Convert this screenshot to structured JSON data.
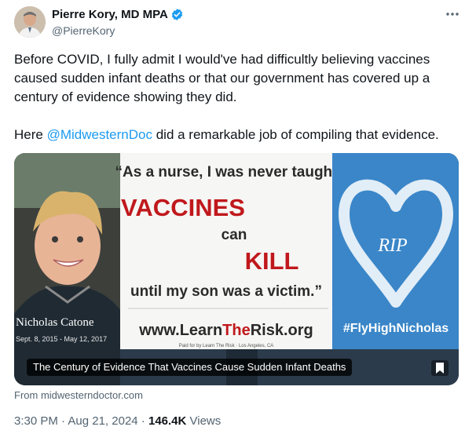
{
  "author": {
    "name": "Pierre Kory, MD MPA",
    "handle": "@PierreKory",
    "verified_icon": "verified-badge-icon"
  },
  "more_icon": "more-options-icon",
  "text": {
    "para1": "Before COVID, I fully admit I would've had difficultly believing vaccines caused sudden infant deaths or that our government has covered up a century of evidence showing they did.",
    "para2_prefix": "Here ",
    "mention": "@MidwesternDoc",
    "para2_suffix": " did a remarkable job of compiling that evidence."
  },
  "card": {
    "billboard": {
      "quote_line1": "“As a nurse, I was never taught",
      "word_vaccines": "VACCINES",
      "word_can": "can",
      "word_kill": "KILL",
      "quote_line_end": "until my son was a victim.”",
      "name": "Nicholas Catone",
      "dates": "Sept. 8, 2015 - May 12, 2017",
      "url_prefix": "www.Learn",
      "url_middle": "The",
      "url_suffix": "Risk.org",
      "paid_for": "Paid for by Learn The Risk · Los Angeles, CA",
      "rip": "RIP",
      "hashtag": "#FlyHighNicholas"
    },
    "caption": "The Century of Evidence That Vaccines Cause Sudden Infant Deaths",
    "bookmark_icon": "bookmark-icon"
  },
  "source": "From midwesterndoctor.com",
  "meta": {
    "time": "3:30 PM",
    "sep": " · ",
    "date": "Aug 21, 2024",
    "views_count": "146.4K",
    "views_label": " Views"
  },
  "colors": {
    "accent": "#1d9bf0",
    "secondary_text": "#536471",
    "billboard_red": "#c0181c",
    "sky_blue": "#3a86c8"
  }
}
